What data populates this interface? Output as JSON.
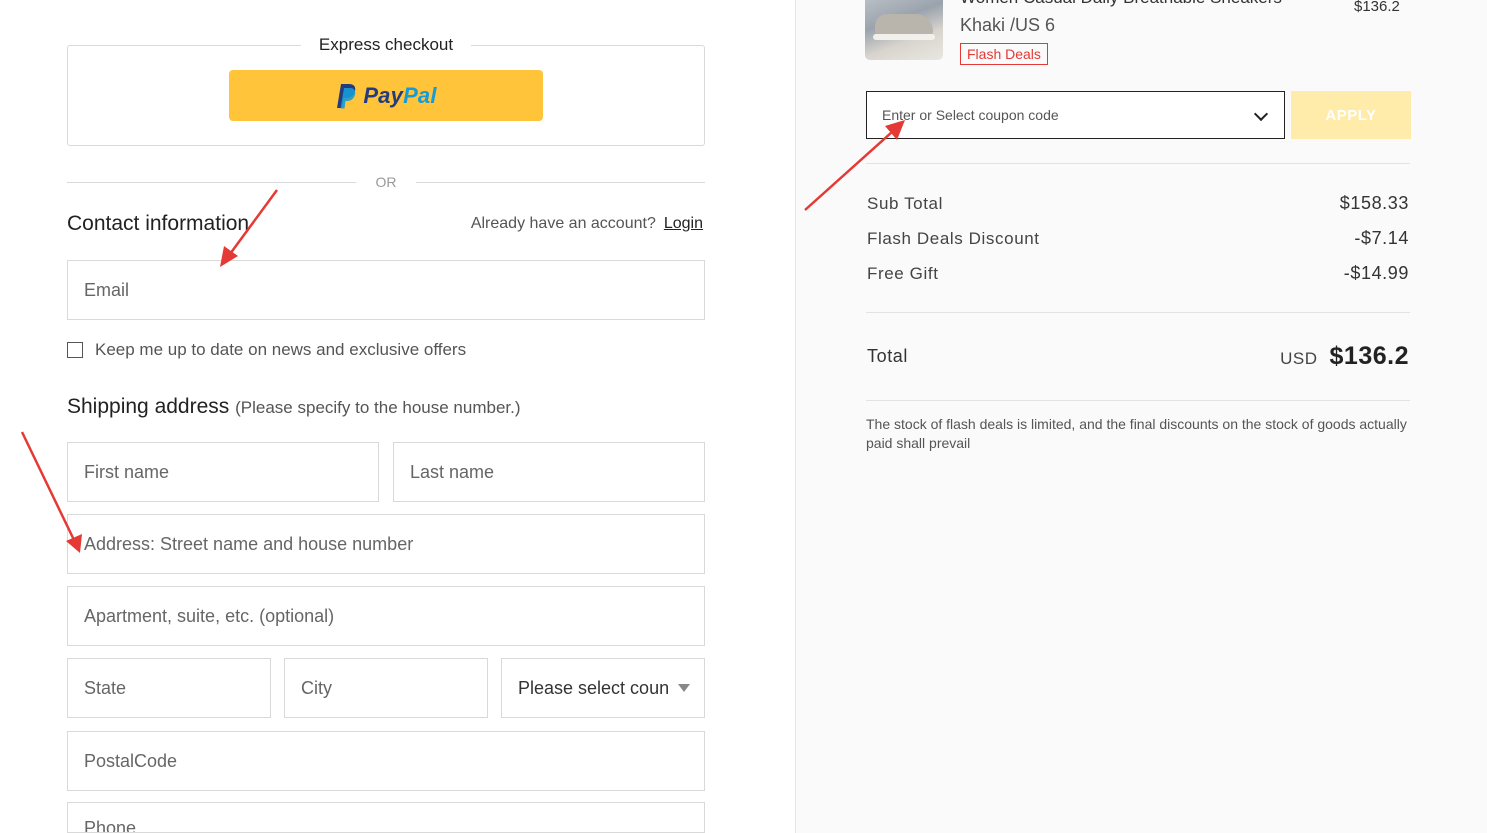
{
  "express": {
    "title": "Express checkout",
    "paypal_part1": "Pay",
    "paypal_part2": "Pal"
  },
  "divider_text": "OR",
  "contact": {
    "title": "Contact information",
    "account_prompt": "Already have an account?",
    "login_label": "Login",
    "email_placeholder": "Email",
    "newsletter_label": "Keep me up to date on news and exclusive offers"
  },
  "shipping": {
    "title": "Shipping address",
    "subtitle": "(Please specify to the house number.)",
    "first_name_placeholder": "First name",
    "last_name_placeholder": "Last name",
    "address_placeholder": "Address: Street name and house number",
    "apartment_placeholder": "Apartment, suite, etc. (optional)",
    "state_placeholder": "State",
    "city_placeholder": "City",
    "country_select": "Please select country",
    "postal_placeholder": "PostalCode",
    "phone_placeholder": "Phone"
  },
  "product": {
    "title": "Women Casual Daily Breathable Sneakers",
    "variant": "Khaki /US 6",
    "badge": "Flash Deals",
    "price": "$136.2"
  },
  "coupon": {
    "placeholder": "Enter or Select coupon code",
    "apply_label": "APPLY"
  },
  "summary": {
    "subtotal_label": "Sub Total",
    "subtotal_value": "$158.33",
    "flash_label": "Flash Deals Discount",
    "flash_value": "-$7.14",
    "gift_label": "Free Gift",
    "gift_value": "-$14.99",
    "total_label": "Total",
    "currency": "USD",
    "total_value": "$136.2",
    "note": "The stock of flash deals is limited, and the final discounts on the stock of goods actually paid shall prevail"
  },
  "colors": {
    "paypal_yellow": "#ffc439",
    "paypal_dark": "#253b80",
    "paypal_light": "#179bd7",
    "badge_red": "#e53935",
    "apply_disabled": "#ffecaa",
    "annotation_arrow": "#e53935"
  }
}
